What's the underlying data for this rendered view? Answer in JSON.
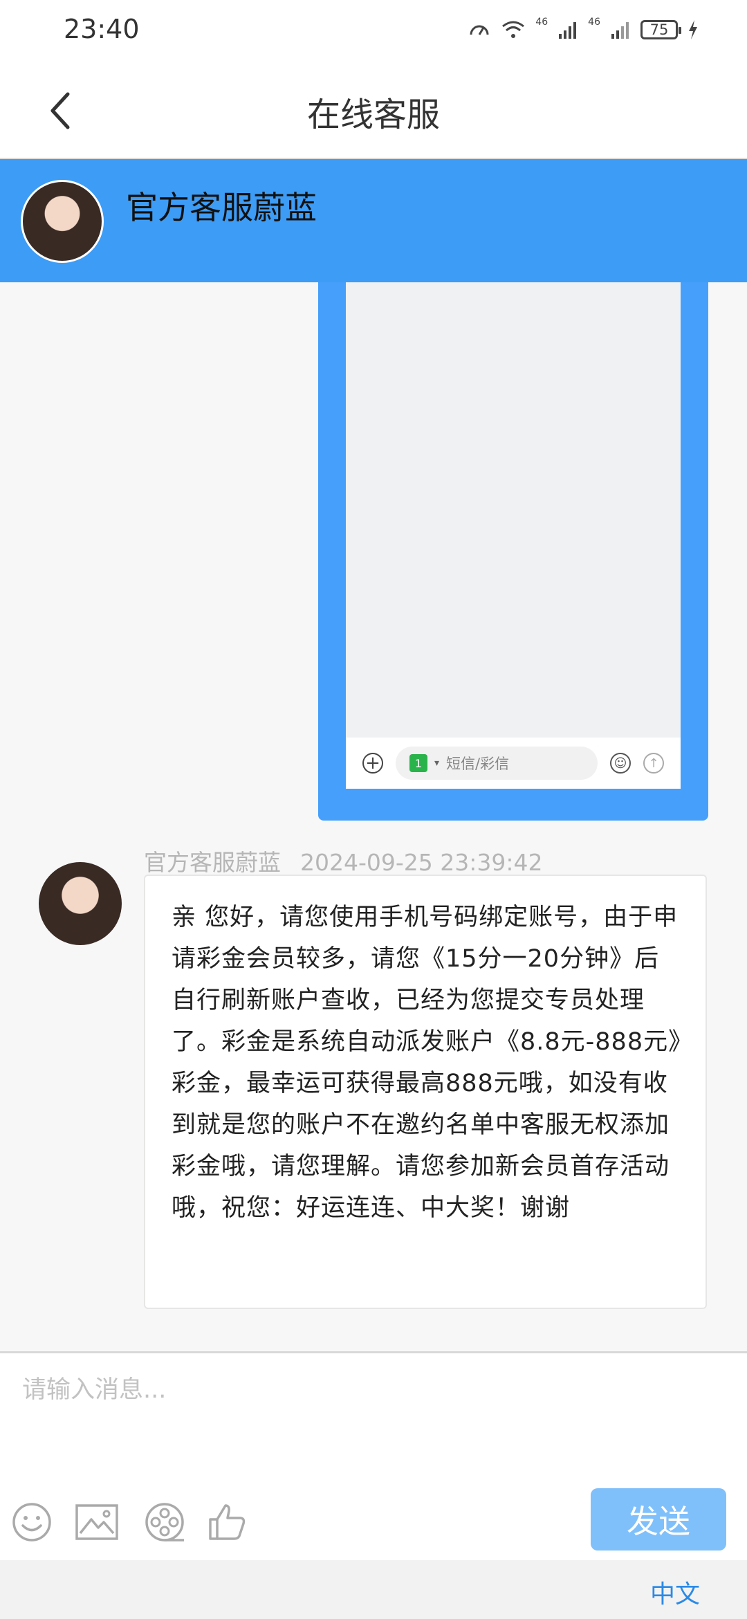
{
  "status_bar": {
    "time": "23:40",
    "battery": "75",
    "network_left": "46",
    "network_right": "46"
  },
  "header": {
    "title": "在线客服",
    "back_icon": "chevron-left-icon"
  },
  "agent": {
    "name": "官方客服蔚蓝"
  },
  "image_message": {
    "sms_placeholder": "短信/彩信",
    "sim_label": "1"
  },
  "message": {
    "sender": "官方客服蔚蓝",
    "timestamp": "2024-09-25 23:39:42",
    "text": "亲 您好，请您使用手机号码绑定账号，由于申请彩金会员较多，请您《15分一20分钟》后自行刷新账户查收，已经为您提交专员处理了。彩金是系统自动派发账户《8.8元-888元》彩金，最幸运可获得最高888元哦，如没有收到就是您的账户不在邀约名单中客服无权添加彩金哦，请您理解。请您参加新会员首存活动哦，祝您：好运连连、中大奖！谢谢"
  },
  "composer": {
    "placeholder": "请输入消息...",
    "send_label": "发送",
    "tools": [
      "emoji-icon",
      "image-icon",
      "video-icon",
      "thumbs-up-icon"
    ]
  },
  "footer": {
    "language": "中文"
  },
  "colors": {
    "primary_blue": "#3d9cf5",
    "send_button": "#7fc0fb",
    "link_blue": "#2b8ae6"
  }
}
